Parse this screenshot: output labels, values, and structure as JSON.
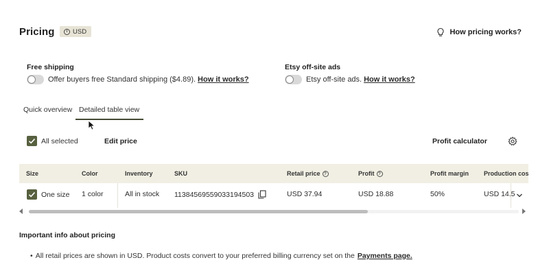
{
  "header": {
    "title": "Pricing",
    "currency_badge": "USD",
    "how_pricing_link": "How pricing works?"
  },
  "free_shipping": {
    "label": "Free shipping",
    "toggle_text": "Offer buyers free Standard shipping ($4.89).",
    "how_link": "How it works?",
    "enabled": false
  },
  "offsite_ads": {
    "label": "Etsy off-site ads",
    "toggle_text": "Etsy off-site ads.",
    "how_link": "How it works?",
    "enabled": false
  },
  "tabs": [
    {
      "label": "Quick overview",
      "active": false
    },
    {
      "label": "Detailed table view",
      "active": true
    }
  ],
  "toolbar": {
    "all_selected_label": "All selected",
    "edit_price_label": "Edit price",
    "profit_calculator_label": "Profit calculator"
  },
  "table": {
    "columns": [
      "Size",
      "Color",
      "Inventory",
      "SKU",
      "Retail price",
      "Profit",
      "Profit margin",
      "Production cos"
    ],
    "rows": [
      {
        "size": "One size",
        "color": "1 color",
        "inventory": "All in stock",
        "sku": "11384569559033194503",
        "retail_price": "USD 37.94",
        "profit": "USD 18.88",
        "profit_margin": "50%",
        "production_cost": "USD 14.5"
      }
    ]
  },
  "scroll": {
    "horizontal_position": 0
  },
  "important": {
    "title": "Important info about pricing",
    "bullet_text": "All retail prices are shown in USD. Product costs convert to your preferred billing currency set on the",
    "bullet_link": "Payments page."
  },
  "colors": {
    "accent": "#57603f",
    "badge_bg": "#e7e4d6",
    "table_header_bg": "#f1efe3"
  },
  "icons": {
    "currency": "info-icon",
    "how_pricing": "lightbulb-icon",
    "settings": "gear-icon",
    "sku_copy": "copy-icon",
    "row_expand": "chevron-down-icon",
    "cursor": "mouse-pointer-icon"
  }
}
